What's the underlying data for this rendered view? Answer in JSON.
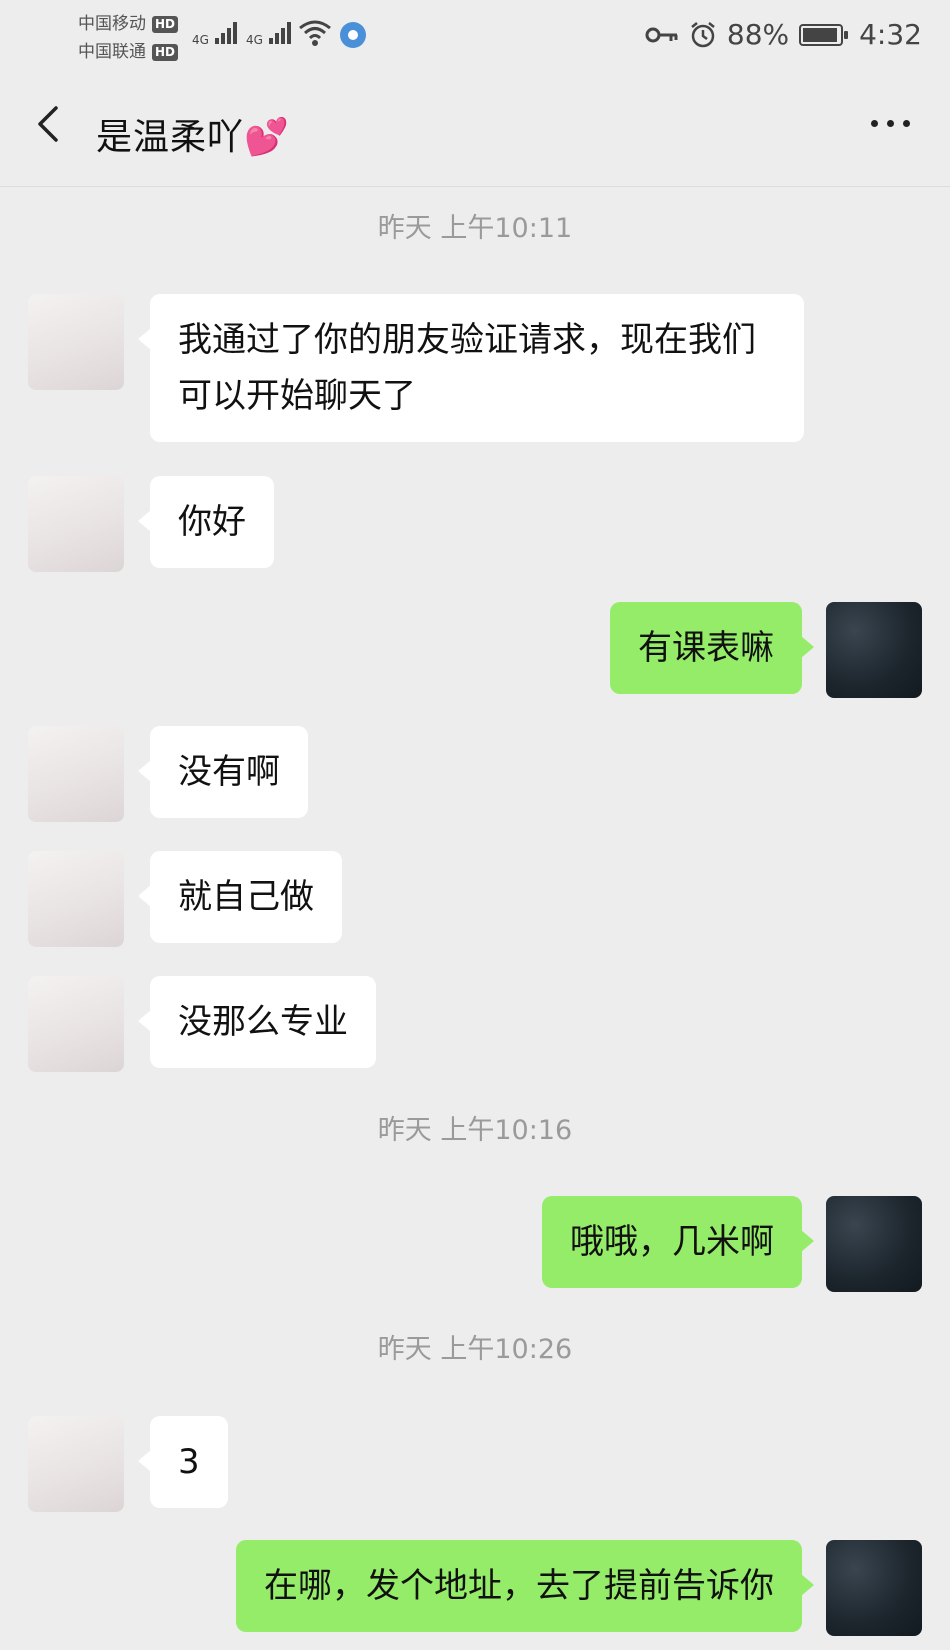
{
  "status": {
    "carrier1": "中国移动",
    "carrier2": "中国联通",
    "hd": "HD",
    "net1": "4G",
    "net2": "4G",
    "battery": "88%",
    "time": "4:32"
  },
  "header": {
    "title": "是温柔吖💕"
  },
  "messages": [
    {
      "type": "time",
      "text": "昨天 上午10:11"
    },
    {
      "type": "in",
      "text": "我通过了你的朋友验证请求，现在我们可以开始聊天了"
    },
    {
      "type": "in",
      "text": "你好"
    },
    {
      "type": "out",
      "text": "有课表嘛"
    },
    {
      "type": "in",
      "text": "没有啊"
    },
    {
      "type": "in",
      "text": "就自己做"
    },
    {
      "type": "in",
      "text": "没那么专业"
    },
    {
      "type": "time",
      "text": "昨天 上午10:16"
    },
    {
      "type": "out",
      "text": "哦哦，几米啊"
    },
    {
      "type": "time",
      "text": "昨天 上午10:26"
    },
    {
      "type": "in",
      "text": "3"
    },
    {
      "type": "out",
      "text": "在哪，发个地址，去了提前告诉你"
    }
  ],
  "colors": {
    "background": "#ededed",
    "incoming_bubble": "#ffffff",
    "outgoing_bubble": "#95ec69"
  },
  "icons": {
    "back": "chevron-left-icon",
    "more": "more-dots-icon",
    "key": "key-icon",
    "alarm": "alarm-icon",
    "wifi": "wifi-icon",
    "battery": "battery-icon"
  }
}
